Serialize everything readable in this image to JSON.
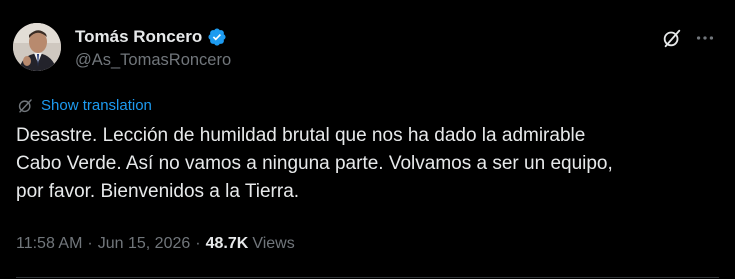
{
  "author": {
    "display_name": "Tomás Roncero",
    "handle": "@As_TomasRoncero",
    "verified": true,
    "verified_color": "#1d9bf0",
    "avatar_icon": "avatar-photo"
  },
  "actions": {
    "grok_icon": "grok-icon",
    "more_icon": "more-options-icon"
  },
  "translation": {
    "icon": "translate-icon",
    "label": "Show translation",
    "color": "#1d9bf0"
  },
  "tweet": {
    "text": "Desastre. Lección de humildad brutal que nos ha dado la admirable\nCabo Verde. Así no vamos a ninguna parte. Volvamos a ser un equipo,\npor favor. Bienvenidos a la Tierra."
  },
  "meta": {
    "time": "11:58 AM",
    "separator": "·",
    "date": "Jun 15, 2026",
    "views_count": "48.7K",
    "views_label": "Views"
  },
  "colors": {
    "background": "#000000",
    "text_primary": "#e7e9ea",
    "text_secondary": "#71767b",
    "accent": "#1d9bf0"
  }
}
